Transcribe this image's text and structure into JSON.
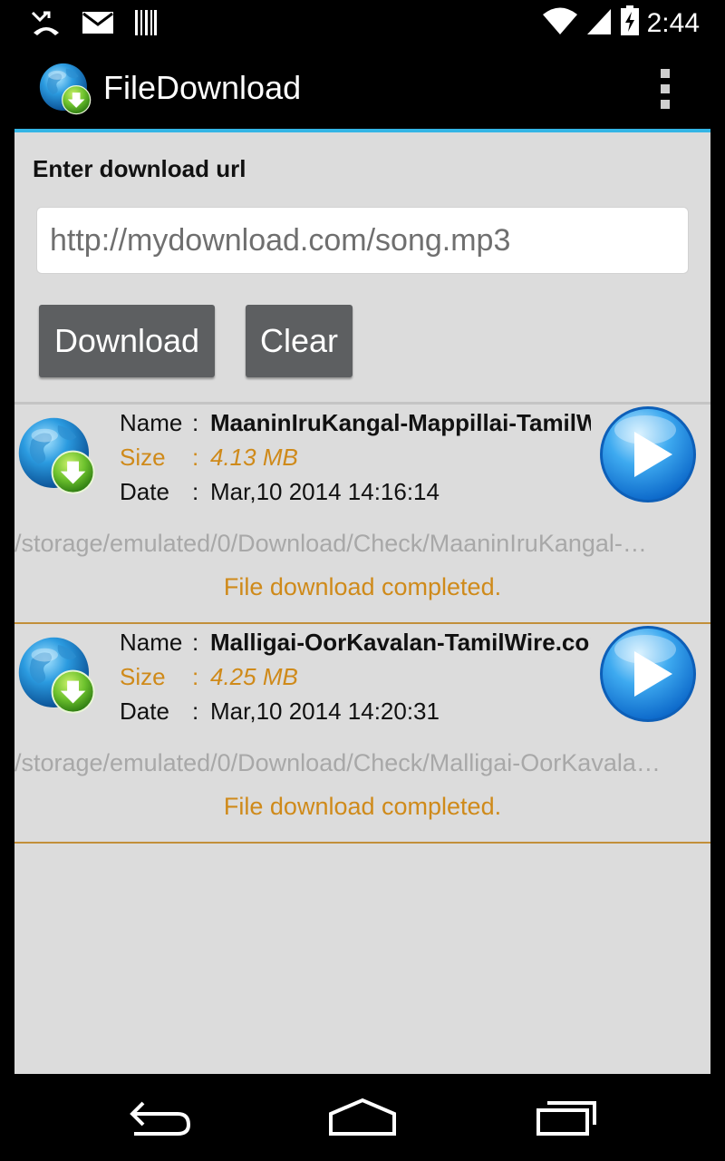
{
  "status_bar": {
    "time": "2:44",
    "left_icons": [
      "missed-call-icon",
      "mail-icon",
      "barcode-icon"
    ],
    "right_icons": [
      "wifi-icon",
      "cell-signal-icon",
      "battery-charging-icon"
    ]
  },
  "action_bar": {
    "title": "FileDownload",
    "logo_icon": "globe-download-icon",
    "menu_icon": "overflow-menu-icon"
  },
  "form": {
    "label": "Enter download url",
    "url_placeholder": "http://mydownload.com/song.mp3",
    "url_value": "",
    "download_label": "Download",
    "clear_label": "Clear"
  },
  "downloads": [
    {
      "name_label": "Name",
      "name": "MaaninIruKangal-Mappillai-TamilWire.com",
      "size_label": "Size",
      "size": "4.13 MB",
      "date_label": "Date",
      "date": "Mar,10 2014 14:16:14",
      "path": "/storage/emulated/0/Download/Check/MaaninIruKangal-…",
      "status": "File download completed."
    },
    {
      "name_label": "Name",
      "name": "Malligai-OorKavalan-TamilWire.com",
      "size_label": "Size",
      "size": "4.25 MB",
      "date_label": "Date",
      "date": "Mar,10 2014 14:20:31",
      "path": "/storage/emulated/0/Download/Check/Malligai-OorKavala…",
      "status": "File download completed."
    }
  ],
  "nav_bar": {
    "icons": [
      "back-icon",
      "home-icon",
      "recent-apps-icon"
    ]
  },
  "colors": {
    "accent_line": "#33b5e5",
    "size_text": "#cf8a1a",
    "button_bg": "#5d5f61",
    "background": "#dcdcdc"
  }
}
